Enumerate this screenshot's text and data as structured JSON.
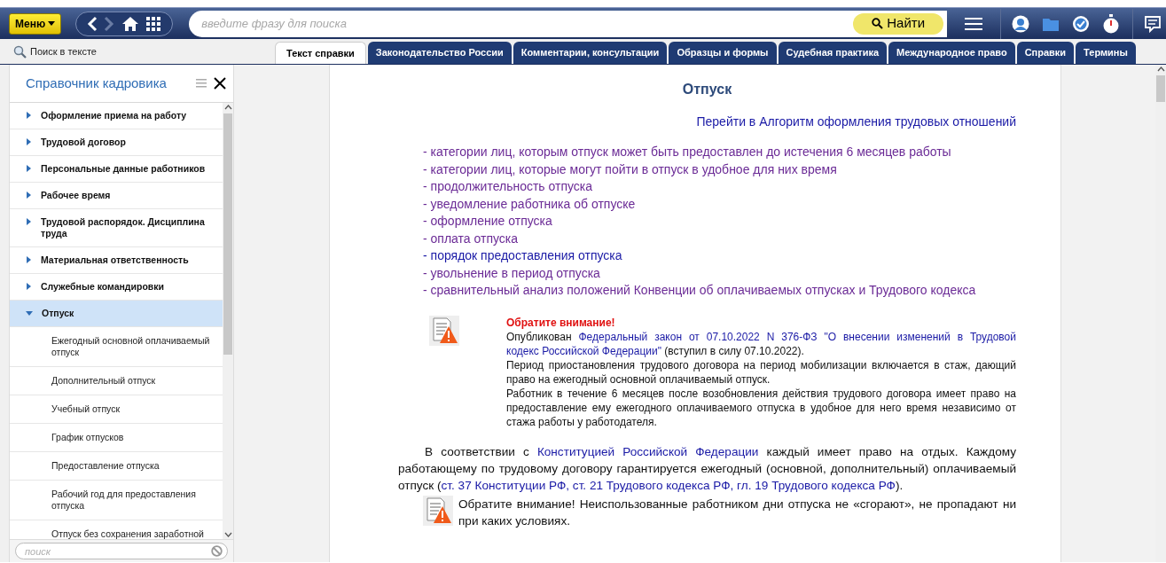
{
  "toolbar": {
    "menu_button": "Меню",
    "search": {
      "placeholder": "введите фразу для поиска"
    },
    "find_button": "Найти"
  },
  "text_search": "Поиск в тексте",
  "tabs": [
    {
      "label": "Текст справки",
      "selected": true
    },
    {
      "label": "Законодательство России",
      "selected": false
    },
    {
      "label": "Комментарии, консультации",
      "selected": false
    },
    {
      "label": "Образцы и формы",
      "selected": false
    },
    {
      "label": "Судебная практика",
      "selected": false
    },
    {
      "label": "Международное право",
      "selected": false
    },
    {
      "label": "Справки",
      "selected": false
    },
    {
      "label": "Термины",
      "selected": false
    }
  ],
  "sidebar": {
    "title": "Справочник кадровика",
    "items": [
      {
        "label": "Оформление приема на работу",
        "expanded": false,
        "selected": false
      },
      {
        "label": "Трудовой договор",
        "expanded": false,
        "selected": false
      },
      {
        "label": "Персональные данные работников",
        "expanded": false,
        "selected": false
      },
      {
        "label": "Рабочее время",
        "expanded": false,
        "selected": false
      },
      {
        "label": "Трудовой распорядок. Дисциплина труда",
        "expanded": false,
        "selected": false
      },
      {
        "label": "Материальная ответственность",
        "expanded": false,
        "selected": false
      },
      {
        "label": "Служебные командировки",
        "expanded": false,
        "selected": false
      },
      {
        "label": "Отпуск",
        "expanded": true,
        "selected": true,
        "children": [
          {
            "label": "Ежегодный основной оплачиваемый отпуск",
            "selected": false
          },
          {
            "label": "Дополнительный отпуск",
            "selected": false
          },
          {
            "label": "Учебный отпуск",
            "selected": false
          },
          {
            "label": "График отпусков",
            "selected": false
          },
          {
            "label": "Предоставление отпуска",
            "selected": false
          },
          {
            "label": "Рабочий год для предоставления отпуска",
            "selected": false
          },
          {
            "label": "Отпуск без сохранения заработной",
            "selected": false
          }
        ]
      }
    ],
    "search": {
      "placeholder": "поиск"
    }
  },
  "document": {
    "title": "Отпуск",
    "algorithm_link": "Перейти в Алгоритм оформления трудовых отношений",
    "topics": [
      {
        "text": "- категории лиц, которым отпуск может быть предоставлен до истечения 6 месяцев работы",
        "visited": true
      },
      {
        "text": "- категории лиц, которые могут пойти в отпуск в удобное для них время",
        "visited": true
      },
      {
        "text": "- продолжительность отпуска",
        "visited": true
      },
      {
        "text": "- уведомление работника об отпуске",
        "visited": true
      },
      {
        "text": "- оформление отпуска",
        "visited": true
      },
      {
        "text": "- оплата отпуска",
        "visited": true
      },
      {
        "text": "- порядок предоставления отпуска",
        "visited": false
      },
      {
        "text": "- увольнение в период отпуска",
        "visited": true
      },
      {
        "text": "- сравнительный анализ положений Конвенции об оплачиваемых отпусках и Трудового кодекса",
        "visited": true
      }
    ],
    "notice": {
      "heading": "Обратите внимание!",
      "paragraphs": [
        [
          {
            "text": "Опубликован ",
            "link": false
          },
          {
            "text": "Федеральный закон от 07.10.2022 N 376-ФЗ \"О внесении изменений в Трудовой",
            "link": true
          },
          {
            "text": "кодекс Российской Федерации\"",
            "link": true
          },
          {
            "text": " (вступил в силу 07.10.2022).",
            "link": false
          }
        ],
        [
          {
            "text": "Период приостановления трудового договора на период мобилизации включается в стаж, дающий право на ежегодный основной оплачиваемый отпуск.",
            "link": false
          }
        ],
        [
          {
            "text": "Работник в течение 6 месяцев после возобновления действия трудового договора имеет право на предоставление ему ежегодного оплачиваемого отпуска в удобное для него время независимо от стажа работы у работодателя.",
            "link": false
          }
        ]
      ]
    },
    "paragraphs": [
      {
        "kind": "text",
        "segments": [
          {
            "text": "В соответствии с ",
            "link": false
          },
          {
            "text": "Конституцией Российской Федерации",
            "link": true
          },
          {
            "text": " каждый имеет право на отдых. Каждому работающему по трудовому договору гарантируется ежегодный (основной, дополнительный) оплачиваемый отпуск (",
            "link": false
          },
          {
            "text": "ст. 37 Конституции РФ, ст. 21 Трудового кодекса РФ, гл. 19 Трудового кодекса РФ",
            "link": true
          },
          {
            "text": ").",
            "link": false
          }
        ]
      },
      {
        "kind": "notice",
        "segments": [
          {
            "text": "Обратите внимание! Неиспользованные работником дни отпуска не «сгорают», не пропадают ни при каких условиях.",
            "link": false
          }
        ]
      }
    ]
  }
}
